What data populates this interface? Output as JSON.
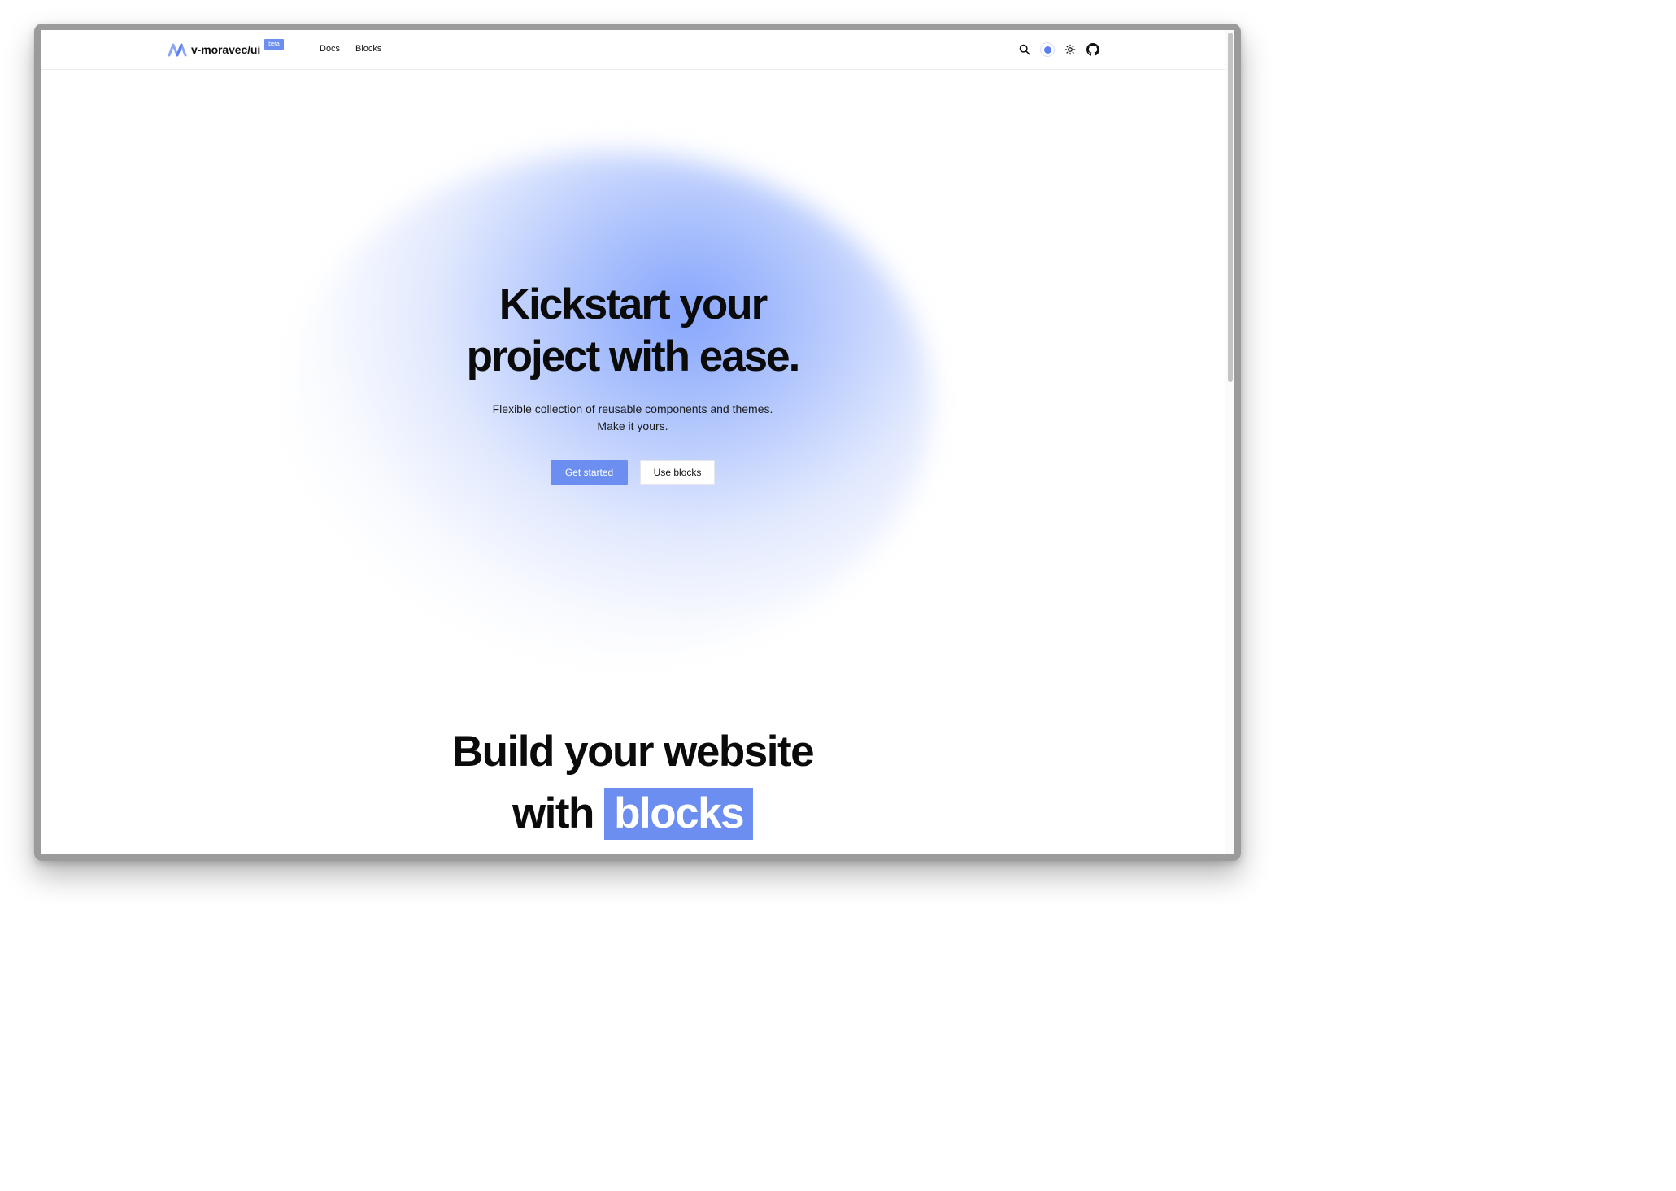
{
  "header": {
    "logo_text": "v-moravec/ui",
    "badge": "beta",
    "nav": [
      "Docs",
      "Blocks"
    ],
    "tools": [
      "search-icon",
      "color-theme-dot",
      "sun-icon",
      "github-icon"
    ]
  },
  "hero": {
    "title_line1": "Kickstart your",
    "title_line2": "project with ease.",
    "subtitle_line1": "Flexible collection of reusable components and themes.",
    "subtitle_line2": "Make it yours.",
    "primary_button": "Get started",
    "secondary_button": "Use blocks"
  },
  "section": {
    "title_line1": "Build your website",
    "title_line2_prefix": "with",
    "title_line2_highlight": "blocks"
  },
  "colors": {
    "accent": "#6b8ef0",
    "text": "#0b0b0b",
    "background": "#ffffff"
  }
}
